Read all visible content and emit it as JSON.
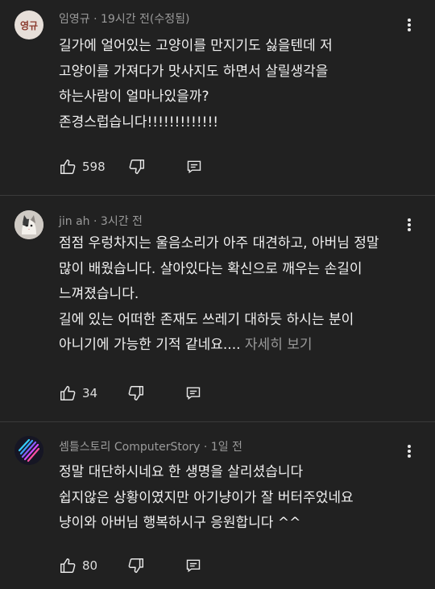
{
  "comments": [
    {
      "author": "임영규",
      "avatar_initials": "영규",
      "time": "19시간 전(수정됨)",
      "lines": [
        "길가에  얼어있는  고양이를  만지기도 싫을텐데    저",
        "고양이를  가져다가 맛사지도 하면서  살릴생각을",
        "하는사람이 얼마나있을까?",
        "존경스럽습니다!!!!!!!!!!!!!"
      ],
      "likes": "598"
    },
    {
      "author": "jin ah",
      "time": "3시간 전",
      "lines": [
        "점점 우렁차지는 울음소리가 아주 대견하고, 아버님 정말",
        "많이 배웠습니다. 살아있다는 확신으로 깨우는 손길이",
        "느껴졌습니다.",
        "길에 있는 어떠한 존재도 쓰레기 대하듯 하시는 분이",
        "아니기에 가능한 기적 같네요...."
      ],
      "read_more": "자세히 보기",
      "likes": "34"
    },
    {
      "author": "셈틀스토리 ComputerStory",
      "time": "1일 전",
      "lines": [
        "정말 대단하시네요 한 생명을 살리셨습니다",
        "쉽지않은 상황이였지만 아기냥이가 잘 버터주었네요",
        "냥이와 아버님 행복하시구 응원합니다 ^^"
      ],
      "likes": "80"
    }
  ],
  "icons": {
    "like": "thumbs-up-icon",
    "dislike": "thumbs-down-icon",
    "reply": "reply-icon",
    "menu": "more-vert-icon"
  }
}
